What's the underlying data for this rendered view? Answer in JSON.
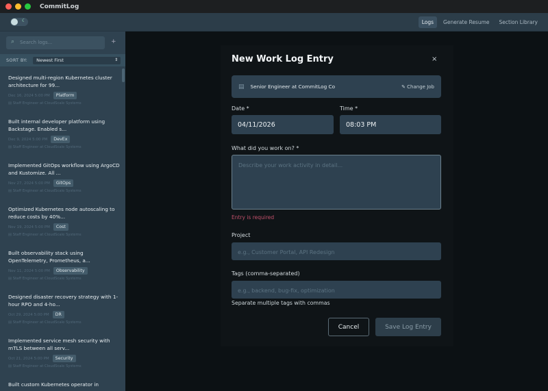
{
  "app": {
    "title": "CommitLog",
    "traffic_colors": [
      "#ff5f57",
      "#febc2e",
      "#28c840"
    ]
  },
  "header": {
    "theme_icon": "moon-icon",
    "nav": [
      {
        "label": "Logs",
        "active": true
      },
      {
        "label": "Generate Resume"
      },
      {
        "label": "Section Library"
      }
    ]
  },
  "sidebar": {
    "search_placeholder": "Search logs...",
    "add": "+",
    "sort_label": "SORT BY:",
    "sort_value": "Newest First",
    "entries": [
      {
        "title": "Designed multi-region Kubernetes cluster architecture for 99...",
        "date": "Dec 16, 2024 5:00 PM",
        "tag": "Platform",
        "job": "Staff Engineer at CloudScale Systems"
      },
      {
        "title": "Built internal developer platform using Backstage. Enabled s...",
        "date": "Dec 9, 2024 5:00 PM",
        "tag": "DevEx",
        "job": "Staff Engineer at CloudScale Systems"
      },
      {
        "title": "Implemented GitOps workflow using ArgoCD and Kustomize. All ...",
        "date": "Nov 27, 2024 5:00 PM",
        "tag": "GitOps",
        "job": "Staff Engineer at CloudScale Systems"
      },
      {
        "title": "Optimized Kubernetes node autoscaling to reduce costs by 40%...",
        "date": "Nov 19, 2024 5:00 PM",
        "tag": "Cost",
        "job": "Staff Engineer at CloudScale Systems"
      },
      {
        "title": "Built observability stack using OpenTelemetry, Prometheus, a...",
        "date": "Nov 11, 2024 5:00 PM",
        "tag": "Observability",
        "job": "Staff Engineer at CloudScale Systems"
      },
      {
        "title": "Designed disaster recovery strategy with 1-hour RPO and 4-ho...",
        "date": "Oct 29, 2024 5:00 PM",
        "tag": "DR",
        "job": "Staff Engineer at CloudScale Systems"
      },
      {
        "title": "Implemented service mesh security with mTLS between all serv...",
        "date": "Oct 21, 2024 5:00 PM",
        "tag": "Security",
        "job": "Staff Engineer at CloudScale Systems"
      },
      {
        "title": "Built custom Kubernetes operator in",
        "date": "",
        "tag": "",
        "job": ""
      }
    ]
  },
  "modal": {
    "title": "New Work Log Entry",
    "close": "×",
    "job": "Senior Engineer at CommitLog Co",
    "change_job": "Change Job",
    "date_label": "Date *",
    "date_value": "04/11/2026",
    "time_label": "Time *",
    "time_value": "08:03 PM",
    "work_label": "What did you work on? *",
    "work_placeholder": "Describe your work activity in detail...",
    "error": "Entry is required",
    "project_label": "Project",
    "project_placeholder": "e.g., Customer Portal, API Redesign",
    "tags_label": "Tags (comma-separated)",
    "tags_placeholder": "e.g., backend, bug-fix, optimization",
    "tags_hint": "Separate multiple tags with commas",
    "cancel": "Cancel",
    "save": "Save Log Entry"
  }
}
